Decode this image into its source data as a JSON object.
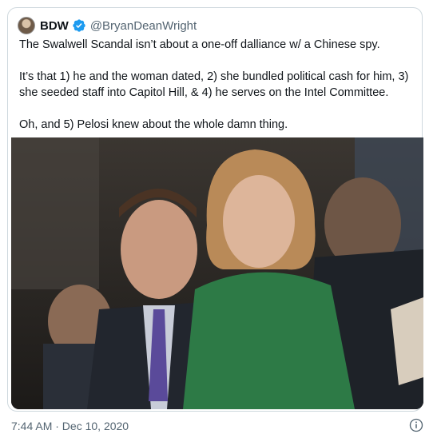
{
  "tweet": {
    "display_name": "BDW",
    "handle": "@BryanDeanWright",
    "verified": true,
    "paragraphs": [
      "The Swalwell Scandal isn’t about a one-off dalliance w/ a Chinese spy.",
      "It’s that 1) he and the woman dated, 2) she bundled political cash for him, 3) she seeded staff into Capitol Hill, & 4) he serves on the Intel Committee.",
      "Oh, and 5) Pelosi knew about the whole damn thing."
    ],
    "timestamp": "7:44 AM · Dec 10, 2020"
  },
  "icons": {
    "verified": "verified-badge-icon",
    "info": "info-icon"
  },
  "colors": {
    "verified_blue": "#1d9bf0",
    "text_primary": "#0f1419",
    "text_secondary": "#536471",
    "border": "#cfd9de"
  }
}
